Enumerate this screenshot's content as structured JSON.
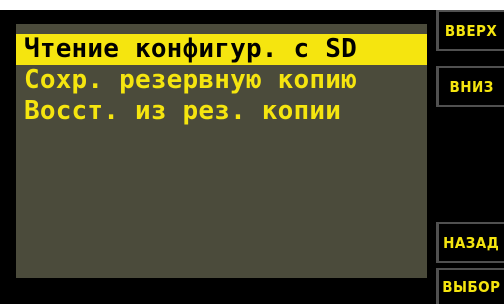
{
  "menu": {
    "items": [
      {
        "label": "Чтение конфигур. с SD",
        "selected": true
      },
      {
        "label": "Сохр. резервную копию",
        "selected": false
      },
      {
        "label": "Восст. из рез. копии",
        "selected": false
      }
    ]
  },
  "softkeys": {
    "up": "ВВЕРХ",
    "down": "ВНИЗ",
    "back": "НАЗАД",
    "select": "ВЫБОР"
  },
  "colors": {
    "accent": "#f5e50f",
    "screen_bg": "#4b4b3b",
    "bezel": "#000000"
  }
}
